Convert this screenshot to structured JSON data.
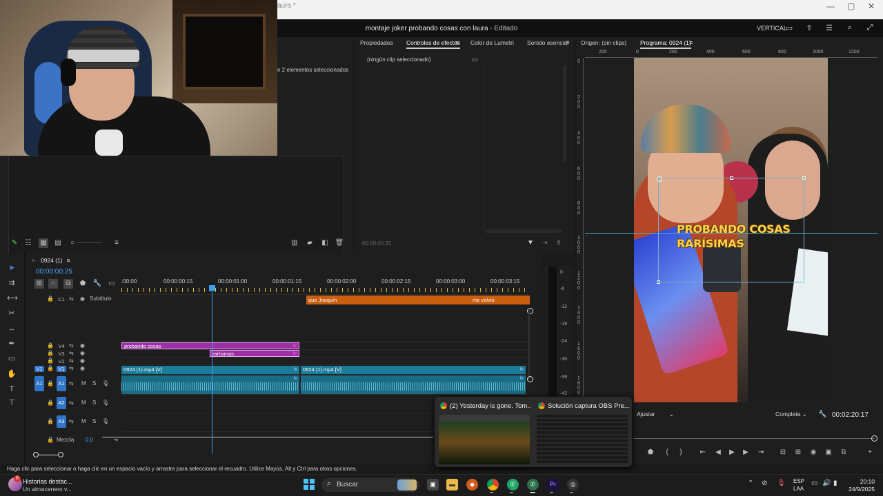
{
  "window": {
    "title_fragment": "aura *",
    "minimize": "—",
    "maximize": "▢",
    "close": "✕"
  },
  "header": {
    "project_title": "montaje joker probando cosas con laura",
    "project_status": " - Editado",
    "layout_label": "VERTICAL"
  },
  "project_panel": {
    "selection_text": "e 2 elementos seleccionados"
  },
  "effects_panel": {
    "tabs": [
      "Propiedades",
      "Controles de efectos",
      "Color de Lumetri",
      "Sonido esencial"
    ],
    "active_tab": "Controles de efectos",
    "no_clip_text": "(ningún clip seleccionado)",
    "timecode": "00:00:00:25"
  },
  "program_monitor": {
    "source_tab": "Origen: (sin clips)",
    "program_tab": "Programa: 0924 (1)",
    "ruler_h": [
      "200",
      "0",
      "200",
      "400",
      "600",
      "800",
      "1000",
      "1200"
    ],
    "ruler_v": [
      "0",
      "2 0 0",
      "4 0 0",
      "6 0 0",
      "8 0 0",
      "1 0 0 0",
      "1 2 0 0",
      "1 4 0 0",
      "1 6 0 0",
      "1 8 0 0"
    ],
    "caption_line1": "PROBANDO COSAS",
    "caption_line2": "RARÍSIMAS",
    "fit_label": "Ajustar",
    "quality_label": "Completa",
    "timecode": "00:02:20:17"
  },
  "timeline": {
    "sequence_name": "0924 (1)",
    "timecode": "00:00:00:25",
    "ruler_labels": [
      ":00:00",
      "00:00:00:15",
      "00:00:01:00",
      "00:00:01:15",
      "00:00:02:00",
      "00:00:02:15",
      "00:00:03:00",
      "00:00:03:15"
    ],
    "tracks": {
      "c1": {
        "name": "C1",
        "label": "Subtítulo"
      },
      "v4": "V4",
      "v3": "V3",
      "v2": "V2",
      "v1": "V1",
      "a1": "A1",
      "a2": "A2",
      "a3": "A3",
      "mix": "Mezcla",
      "mix_value": "0,0",
      "m": "M",
      "s": "S"
    },
    "clips": {
      "sub1": "que Joaquín",
      "sub2": "me volvió",
      "mg1": "probando cosas",
      "mg2": "rarísimas",
      "vid1": "0924 (1).mp4 [V]",
      "vid2": "0924 (1).mp4 [V]",
      "fx": "fx"
    }
  },
  "audio_meter": {
    "ticks": [
      "0",
      "-6",
      "-12",
      "-18",
      "-24",
      "-30",
      "-36",
      "-42"
    ]
  },
  "status_bar": {
    "text": "Haga clic para seleccionar o haga clic en un espacio vacío y arrastre para seleccionar el recuadro. Utilice Mayús, Alt y Ctrl para otras opciones."
  },
  "thumbnail_popup": {
    "items": [
      "(2) Yesterday is gone. Tom...",
      "Solución captura OBS Pre..."
    ]
  },
  "taskbar": {
    "news_badge": "6",
    "news_title": "Historias destac...",
    "news_subtitle": "Un almacenero v...",
    "search_label": "Buscar",
    "premiere_label": "Pr",
    "lang_top": "ESP",
    "lang_bottom": "LAA",
    "time": "20:10",
    "date": "24/9/2025"
  },
  "colors": {
    "accent_blue": "#2f75c9",
    "subtitle_clip": "#c85e10",
    "graphics_clip": "#9c2ea6",
    "video_clip": "#1a7c98",
    "caption_yellow": "#ffd24a"
  }
}
